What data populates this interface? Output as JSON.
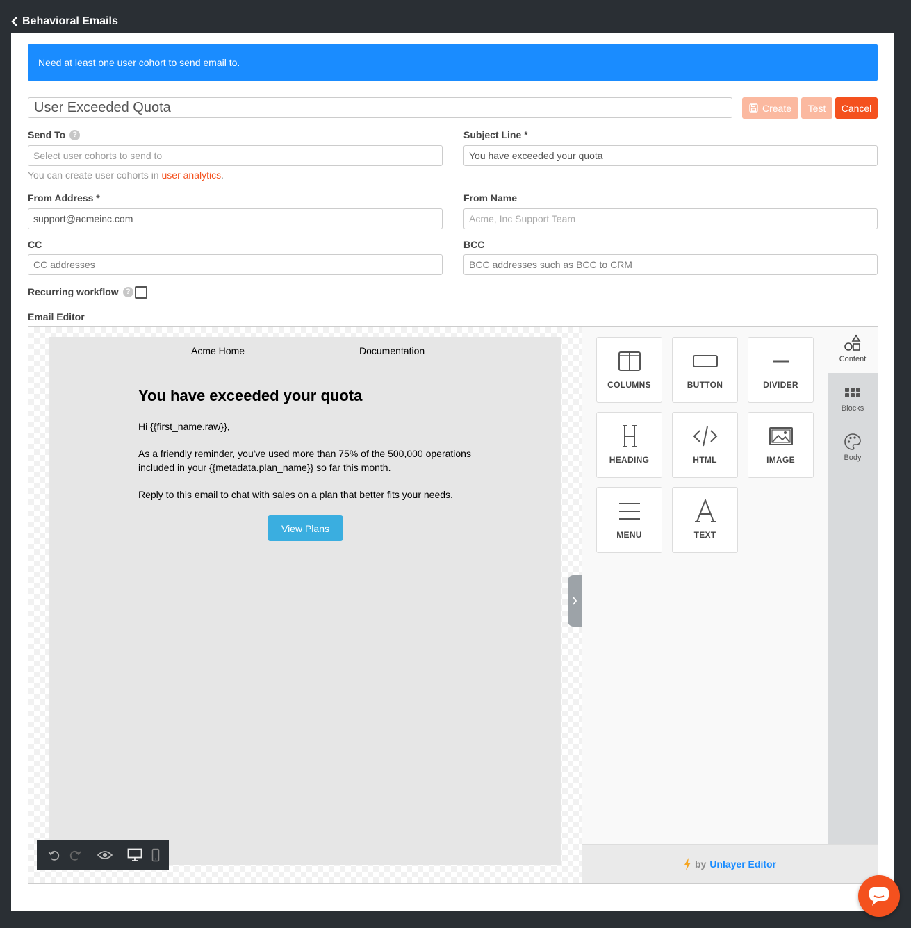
{
  "nav": {
    "back_label": "Behavioral Emails"
  },
  "alert": {
    "message": "Need at least one user cohort to send email to."
  },
  "form": {
    "title_value": "User Exceeded Quota",
    "buttons": {
      "create": "Create",
      "test": "Test",
      "cancel": "Cancel"
    },
    "send_to": {
      "label": "Send To",
      "placeholder": "Select user cohorts to send to",
      "hint_prefix": "You can create user cohorts in ",
      "hint_link": "user analytics",
      "hint_suffix": "."
    },
    "subject": {
      "label": "Subject Line *",
      "value": "You have exceeded your quota"
    },
    "from_address": {
      "label": "From Address *",
      "value": "support@acmeinc.com"
    },
    "from_name": {
      "label": "From Name",
      "placeholder": "Acme, Inc Support Team"
    },
    "cc": {
      "label": "CC",
      "placeholder": "CC addresses"
    },
    "bcc": {
      "label": "BCC",
      "placeholder": "BCC addresses such as BCC to CRM"
    },
    "recurring": {
      "label": "Recurring workflow",
      "checked": false
    },
    "editor_label": "Email Editor"
  },
  "email": {
    "nav_items": [
      "Acme Home",
      "Documentation"
    ],
    "heading": "You have exceeded your quota",
    "greeting": "Hi {{first_name.raw}},",
    "paragraph1": "As a friendly reminder, you've used more than 75% of the 500,000 operations included in your {{metadata.plan_name}} so far this month.",
    "paragraph2": "Reply to this email to chat with sales on a plan that better fits your needs.",
    "button_label": "View Plans"
  },
  "tools": [
    {
      "label": "COLUMNS",
      "icon": "columns-icon"
    },
    {
      "label": "BUTTON",
      "icon": "button-icon"
    },
    {
      "label": "DIVIDER",
      "icon": "divider-icon"
    },
    {
      "label": "HEADING",
      "icon": "heading-icon"
    },
    {
      "label": "HTML",
      "icon": "html-icon"
    },
    {
      "label": "IMAGE",
      "icon": "image-icon"
    },
    {
      "label": "MENU",
      "icon": "menu-icon"
    },
    {
      "label": "TEXT",
      "icon": "text-icon"
    }
  ],
  "side_tabs": [
    {
      "label": "Content",
      "icon": "shapes-icon",
      "active": true
    },
    {
      "label": "Blocks",
      "icon": "grid-icon",
      "active": false
    },
    {
      "label": "Body",
      "icon": "palette-icon",
      "active": false
    }
  ],
  "footer": {
    "by": "by",
    "brand": "Unlayer Editor"
  },
  "colors": {
    "accent_blue": "#1a8cff",
    "accent_orange": "#f4511e",
    "email_button": "#3aaee0"
  }
}
